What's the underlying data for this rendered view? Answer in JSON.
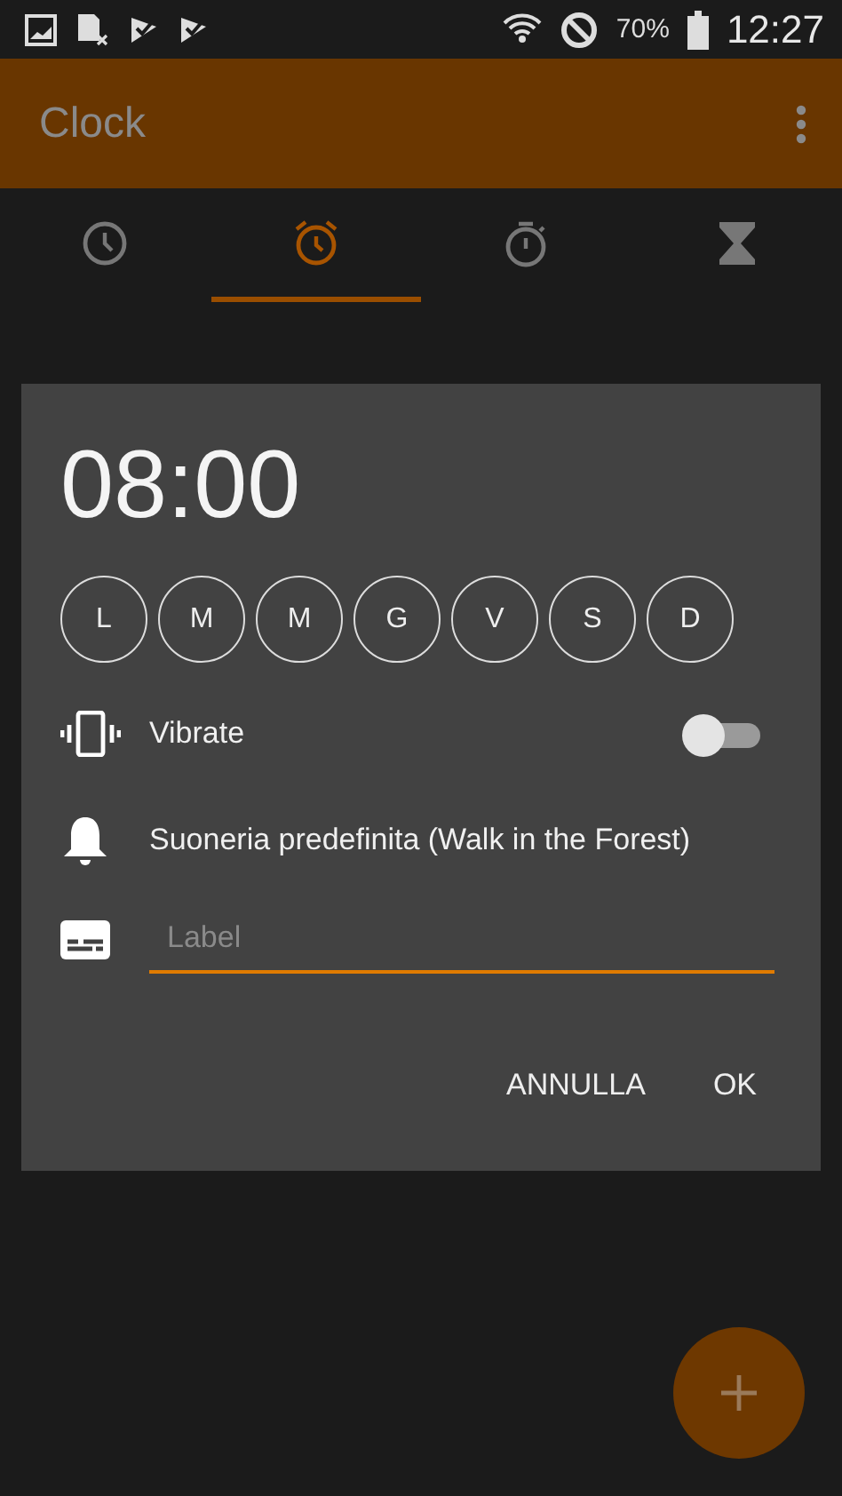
{
  "status_bar": {
    "battery": "70%",
    "time": "12:27"
  },
  "app_bar": {
    "title": "Clock"
  },
  "tabs": [
    {
      "kind": "clock",
      "selected": false
    },
    {
      "kind": "alarm",
      "selected": true
    },
    {
      "kind": "stopwatch",
      "selected": false
    },
    {
      "kind": "timer",
      "selected": false
    }
  ],
  "dialog": {
    "time": "08:00",
    "days": [
      {
        "label": "L",
        "selected": false
      },
      {
        "label": "M",
        "selected": false
      },
      {
        "label": "M",
        "selected": false
      },
      {
        "label": "G",
        "selected": false
      },
      {
        "label": "V",
        "selected": false
      },
      {
        "label": "S",
        "selected": false
      },
      {
        "label": "D",
        "selected": false
      }
    ],
    "vibrate": {
      "label": "Vibrate",
      "on": false
    },
    "ringtone": "Suoneria predefinita (Walk in the Forest)",
    "label_field": {
      "placeholder": "Label"
    },
    "buttons": [
      "ANNULLA",
      "OK"
    ]
  }
}
